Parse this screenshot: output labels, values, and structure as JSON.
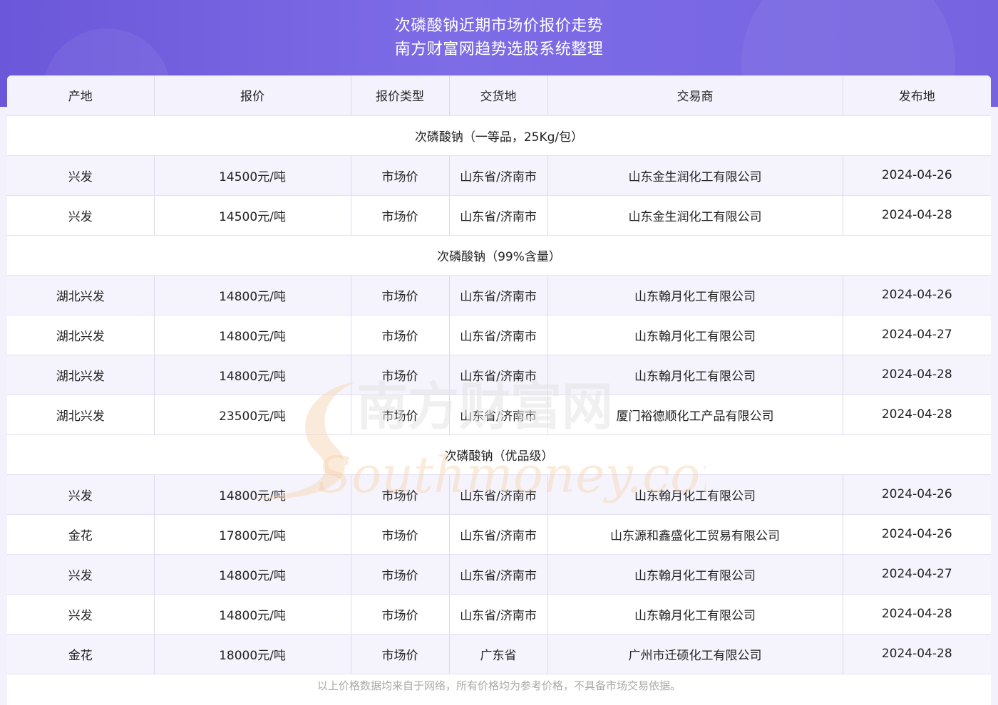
{
  "header": {
    "title_line1": "次磷酸钠近期市场价报价走势",
    "title_line2": "南方财富网趋势选股系统整理"
  },
  "table": {
    "columns": [
      "产地",
      "报价",
      "报价类型",
      "交货地",
      "交易商",
      "发布地"
    ],
    "groups": [
      {
        "name": "次磷酸钠（一等品，25Kg/包）",
        "rows": [
          [
            "兴发",
            "14500元/吨",
            "市场价",
            "山东省/济南市",
            "山东金生润化工有限公司",
            "2024-04-26"
          ],
          [
            "兴发",
            "14500元/吨",
            "市场价",
            "山东省/济南市",
            "山东金生润化工有限公司",
            "2024-04-28"
          ]
        ]
      },
      {
        "name": "次磷酸钠（99%含量）",
        "rows": [
          [
            "湖北兴发",
            "14800元/吨",
            "市场价",
            "山东省/济南市",
            "山东翰月化工有限公司",
            "2024-04-26"
          ],
          [
            "湖北兴发",
            "14800元/吨",
            "市场价",
            "山东省/济南市",
            "山东翰月化工有限公司",
            "2024-04-27"
          ],
          [
            "湖北兴发",
            "14800元/吨",
            "市场价",
            "山东省/济南市",
            "山东翰月化工有限公司",
            "2024-04-28"
          ],
          [
            "湖北兴发",
            "23500元/吨",
            "市场价",
            "山东省/济南市",
            "厦门裕德顺化工产品有限公司",
            "2024-04-28"
          ]
        ]
      },
      {
        "name": "次磷酸钠（优品级）",
        "rows": [
          [
            "兴发",
            "14800元/吨",
            "市场价",
            "山东省/济南市",
            "山东翰月化工有限公司",
            "2024-04-26"
          ],
          [
            "金花",
            "17800元/吨",
            "市场价",
            "山东省/济南市",
            "山东源和鑫盛化工贸易有限公司",
            "2024-04-26"
          ],
          [
            "兴发",
            "14800元/吨",
            "市场价",
            "山东省/济南市",
            "山东翰月化工有限公司",
            "2024-04-27"
          ],
          [
            "兴发",
            "14800元/吨",
            "市场价",
            "山东省/济南市",
            "山东翰月化工有限公司",
            "2024-04-28"
          ],
          [
            "金花",
            "18000元/吨",
            "市场价",
            "广东省",
            "广州市迁硕化工有限公司",
            "2024-04-28"
          ]
        ]
      }
    ]
  },
  "watermark": {
    "cn": "南方财富网",
    "en": "Southmoney.com"
  },
  "footer": {
    "note": "以上价格数据均来自于网络，所有价格均为参考价格，不具备市场交易依据。"
  },
  "colors": {
    "header_gradient_start": "#6b57d9",
    "header_gradient_end": "#7563e0",
    "row_alt": "#f5f4fd",
    "watermark": "#f2c9a0"
  }
}
